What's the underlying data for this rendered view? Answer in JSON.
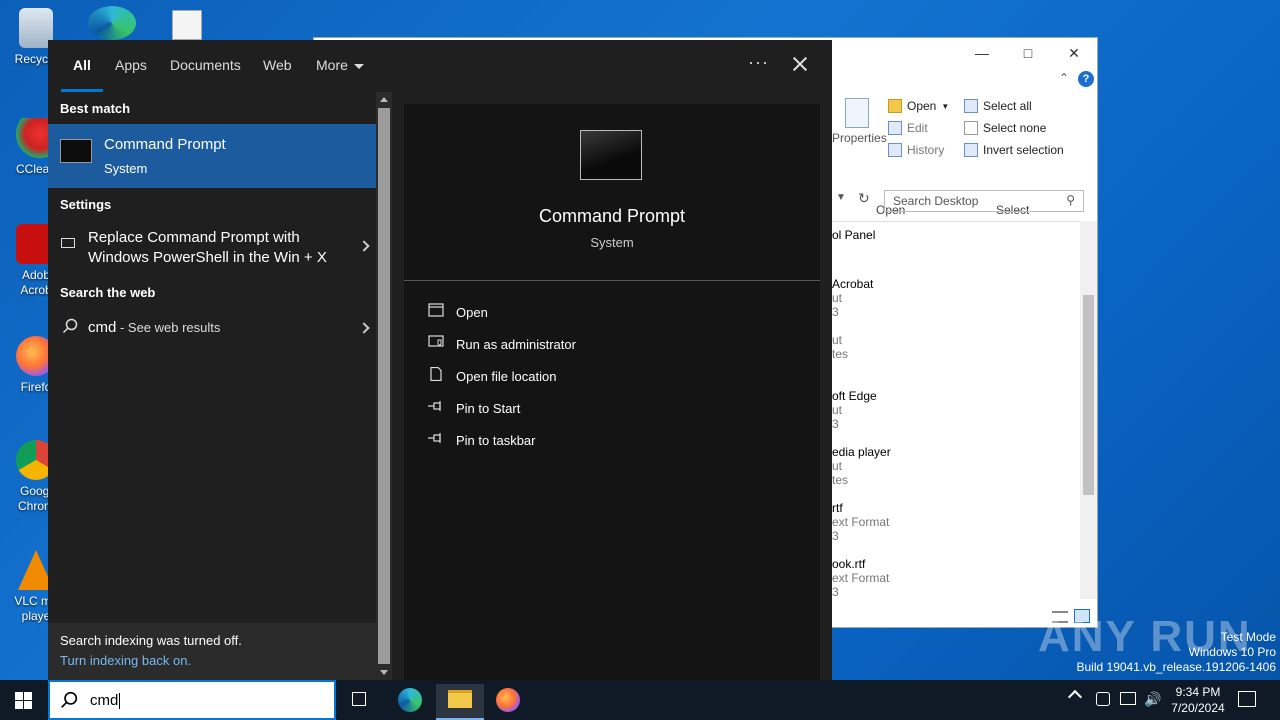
{
  "desktop": {
    "icons": [
      {
        "label": "Recycle"
      },
      {
        "label": "CClean"
      },
      {
        "label": "Adob Acrob"
      },
      {
        "label": "Firefo"
      },
      {
        "label": "Googl Chrom"
      },
      {
        "label": "VLC me playe"
      }
    ]
  },
  "explorer": {
    "ribbon": {
      "properties_label": "Properties",
      "open_label": "Open",
      "edit_label": "Edit",
      "history_label": "History",
      "select_all_label": "Select all",
      "select_none_label": "Select none",
      "invert_selection_label": "Invert selection",
      "group_open": "Open",
      "group_select": "Select"
    },
    "search_placeholder": "Search Desktop",
    "items": [
      {
        "name": "ol Panel",
        "sub1": "",
        "sub2": ""
      },
      {
        "name": "Acrobat",
        "sub1": "ut",
        "sub2": "3"
      },
      {
        "name": "",
        "sub1": "ut",
        "sub2": "tes"
      },
      {
        "name": "oft Edge",
        "sub1": "ut",
        "sub2": "3"
      },
      {
        "name": "edia player",
        "sub1": "ut",
        "sub2": "tes"
      },
      {
        "name": "rtf",
        "sub1": "ext Format",
        "sub2": "3"
      },
      {
        "name": "ook.rtf",
        "sub1": "ext Format",
        "sub2": "3"
      }
    ]
  },
  "search": {
    "tabs": {
      "all": "All",
      "apps": "Apps",
      "documents": "Documents",
      "web": "Web",
      "more": "More"
    },
    "more_options": "···",
    "sections": {
      "best_match": "Best match",
      "settings": "Settings",
      "search_web": "Search the web"
    },
    "best_match": {
      "title": "Command Prompt",
      "subtitle": "System"
    },
    "settings_item": {
      "line1": "Replace Command Prompt with",
      "line2": "Windows PowerShell in the Win + X"
    },
    "web_item": {
      "query": "cmd",
      "suffix": " - See web results"
    },
    "footer": {
      "message": "Search indexing was turned off.",
      "link": "Turn indexing back on."
    },
    "detail": {
      "title": "Command Prompt",
      "subtitle": "System",
      "actions": [
        {
          "label": "Open",
          "icon": "open-icon"
        },
        {
          "label": "Run as administrator",
          "icon": "shield-icon"
        },
        {
          "label": "Open file location",
          "icon": "file-icon"
        },
        {
          "label": "Pin to Start",
          "icon": "pin-icon"
        },
        {
          "label": "Pin to taskbar",
          "icon": "pin-icon"
        }
      ]
    },
    "query": "cmd"
  },
  "taskbar": {
    "time": "9:34 PM",
    "date": "7/20/2024"
  },
  "watermark": {
    "brand": "ANY RUN",
    "line1": "Test Mode",
    "line2": "Windows 10 Pro",
    "line3": "Build 19041.vb_release.191206-1406"
  },
  "colors": {
    "accent": "#0078d7",
    "selection": "#1c5c9e",
    "flyout_bg": "#1f1f1f"
  }
}
